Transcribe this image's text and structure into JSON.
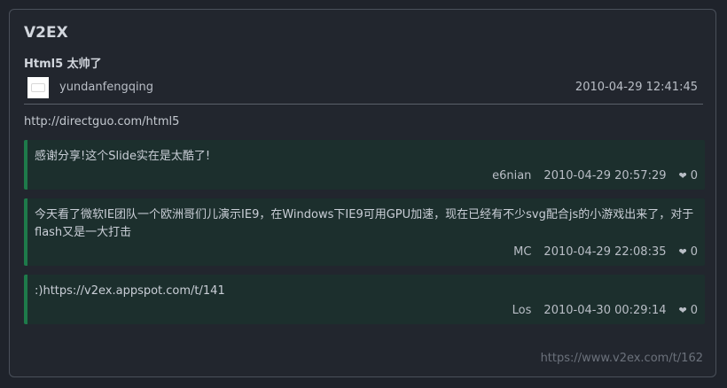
{
  "header": {
    "site_title": "V2EX"
  },
  "post": {
    "title": "Html5 太帅了",
    "author": "yundanfengqing",
    "time": "2010-04-29 12:41:45",
    "content": "http://directguo.com/html5"
  },
  "replies": [
    {
      "text": "感谢分享!这个Slide实在是太酷了!",
      "user": "e6nian",
      "time": "2010-04-29 20:57:29",
      "likes": "0"
    },
    {
      "text": "今天看了微软IE团队一个欧洲哥们儿演示IE9，在Windows下IE9可用GPU加速，现在已经有不少svg配合js的小游戏出来了，对于flash又是一大打击",
      "user": "MC",
      "time": "2010-04-29 22:08:35",
      "likes": "0"
    },
    {
      "text": ":)https://v2ex.appspot.com/t/141",
      "user": "Los",
      "time": "2010-04-30 00:29:14",
      "likes": "0"
    }
  ],
  "footer": {
    "source_url": "https://www.v2ex.com/t/162"
  },
  "icons": {
    "like": "heart-icon",
    "avatar": "avatar-image"
  },
  "colors": {
    "background": "#1f232b",
    "reply_background": "#1c2f2d",
    "reply_accent": "#1e7a4a"
  }
}
